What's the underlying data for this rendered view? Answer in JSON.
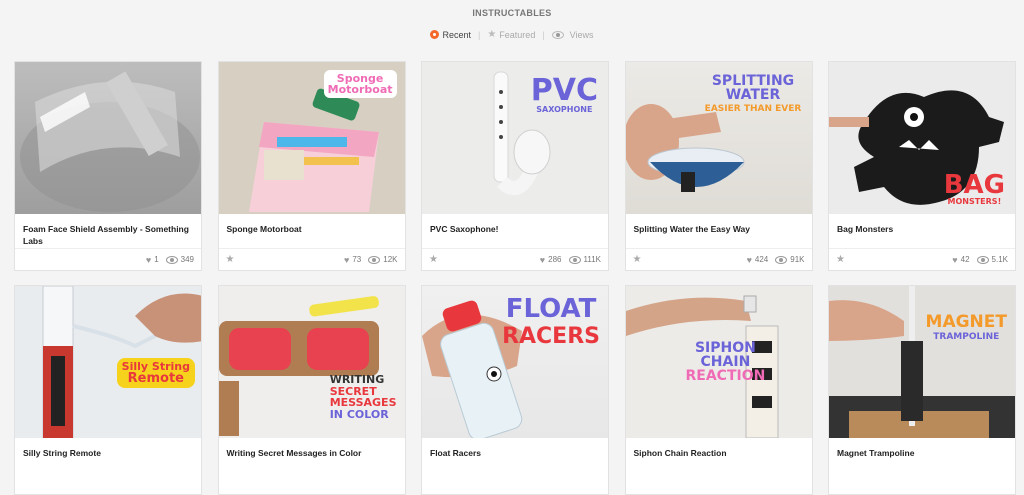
{
  "header": {
    "title": "INSTRUCTABLES",
    "filters": [
      {
        "label": "Recent",
        "icon": "recent-icon",
        "active": true
      },
      {
        "label": "Featured",
        "icon": "star-icon",
        "active": false
      },
      {
        "label": "Views",
        "icon": "eye-icon",
        "active": false
      }
    ]
  },
  "cards": [
    {
      "title": "Foam Face Shield Assembly - Something Labs",
      "likes": "1",
      "views": "349",
      "image_text": []
    },
    {
      "title": "Sponge Motorboat",
      "likes": "73",
      "views": "12K",
      "image_text": [
        "Sponge",
        "Motorboat"
      ]
    },
    {
      "title": "PVC Saxophone!",
      "likes": "286",
      "views": "111K",
      "image_text": [
        "PVC",
        "SAXOPHONE"
      ]
    },
    {
      "title": "Splitting Water the Easy Way",
      "likes": "424",
      "views": "91K",
      "image_text": [
        "SPLITTING WATER",
        "EASIER THAN EVER"
      ]
    },
    {
      "title": "Bag Monsters",
      "likes": "42",
      "views": "5.1K",
      "image_text": [
        "BAG",
        "MONSTERS!"
      ]
    },
    {
      "title": "Silly String Remote",
      "image_text": [
        "Silly String",
        "Remote"
      ]
    },
    {
      "title": "Writing Secret Messages in Color",
      "image_text": [
        "WRITING",
        "SECRET",
        "MESSAGES",
        "IN COLOR"
      ]
    },
    {
      "title": "Float Racers",
      "image_text": [
        "FLOAT",
        "RACERS"
      ]
    },
    {
      "title": "Siphon Chain Reaction",
      "image_text": [
        "SIPHON",
        "CHAIN",
        "REACTION"
      ]
    },
    {
      "title": "Magnet Trampoline",
      "image_text": [
        "MAGNET",
        "TRAMPOLINE"
      ]
    }
  ],
  "colors": {
    "accent": "#f4682a",
    "label_purple": "#6b63d8",
    "label_red": "#e8383d",
    "label_pink": "#f06bb5",
    "label_orange": "#f39a2b"
  }
}
